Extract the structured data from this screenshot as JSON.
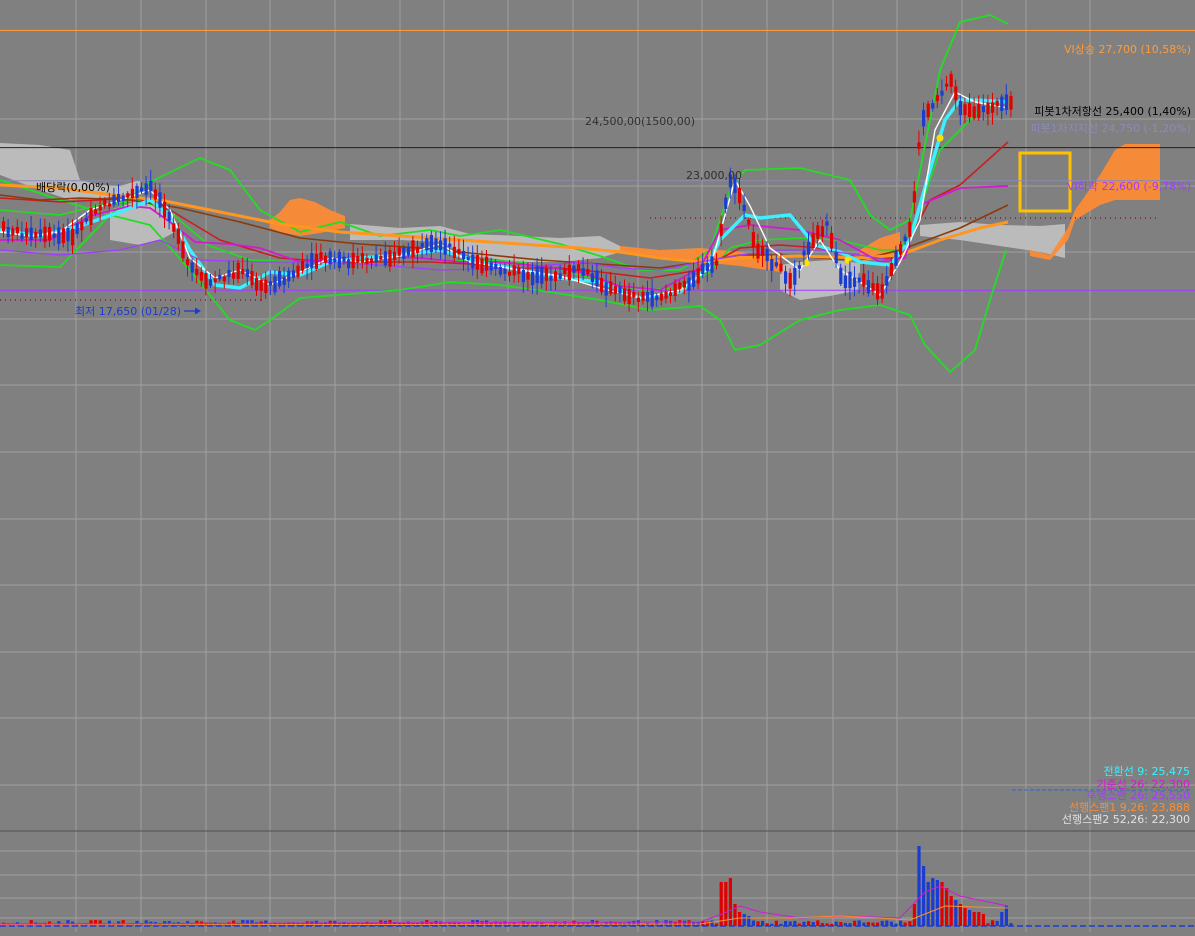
{
  "colors": {
    "background": "#808080",
    "grid": "#a0a0a0",
    "rise": "#e00000",
    "fall": "#1a3cd0",
    "conversion": "#3cf0ff",
    "base": "#d21ad2",
    "lagging": "#a03cff",
    "span1": "#ff8c32",
    "span2": "#c0c0c0",
    "bollinger": "#22dd22",
    "ma5": "#ffffff",
    "ma20": "#c81e1e",
    "ma60": "#8b3a0a",
    "ma120": "#ff9620"
  },
  "level_labels": {
    "upper_limit": "VI상승 27,700 (10,58%)",
    "pivot_resistance": "피봇1차저항선 25,400 (1,40%)",
    "pivot_support": "피봇1차지지선 24,750 (-1,20%)",
    "lower_limit": "VI하락 22,600 (-9,78%)",
    "round_level_a": "24,500,00(1500,00)",
    "round_level_b": "23,000,00",
    "dividend": "배당락(0,00%)",
    "low_marker": "최저 17,650 (01/28)"
  },
  "legend": {
    "conversion": "전환선 9: 25,475",
    "base": "기준선 26: 22,300",
    "lagging": "후행스팬 26: 25,550",
    "span1": "선행스팬1 9,26: 23,888",
    "span2": "선행스팬2 52,26: 22,300"
  },
  "chart_data": {
    "type": "candlestick",
    "indicators": [
      "ichimoku",
      "bollinger",
      "moving averages",
      "volume"
    ],
    "ylim": [
      12000,
      28300
    ],
    "horizontal_levels": [
      {
        "name": "VI상승",
        "value": 27700
      },
      {
        "name": "피봇1차저항선",
        "value": 25400
      },
      {
        "name": "피봇1차지지선",
        "value": 24750
      },
      {
        "name": "VI하락",
        "value": 22600
      }
    ],
    "low": {
      "value": 17650,
      "date": "01/28"
    },
    "ichimoku": {
      "conversion_9": 25475,
      "base_26": 22300,
      "lagging_26": 25550,
      "leading_span1_9_26": 23888,
      "leading_span2_52_26": 22300
    }
  }
}
